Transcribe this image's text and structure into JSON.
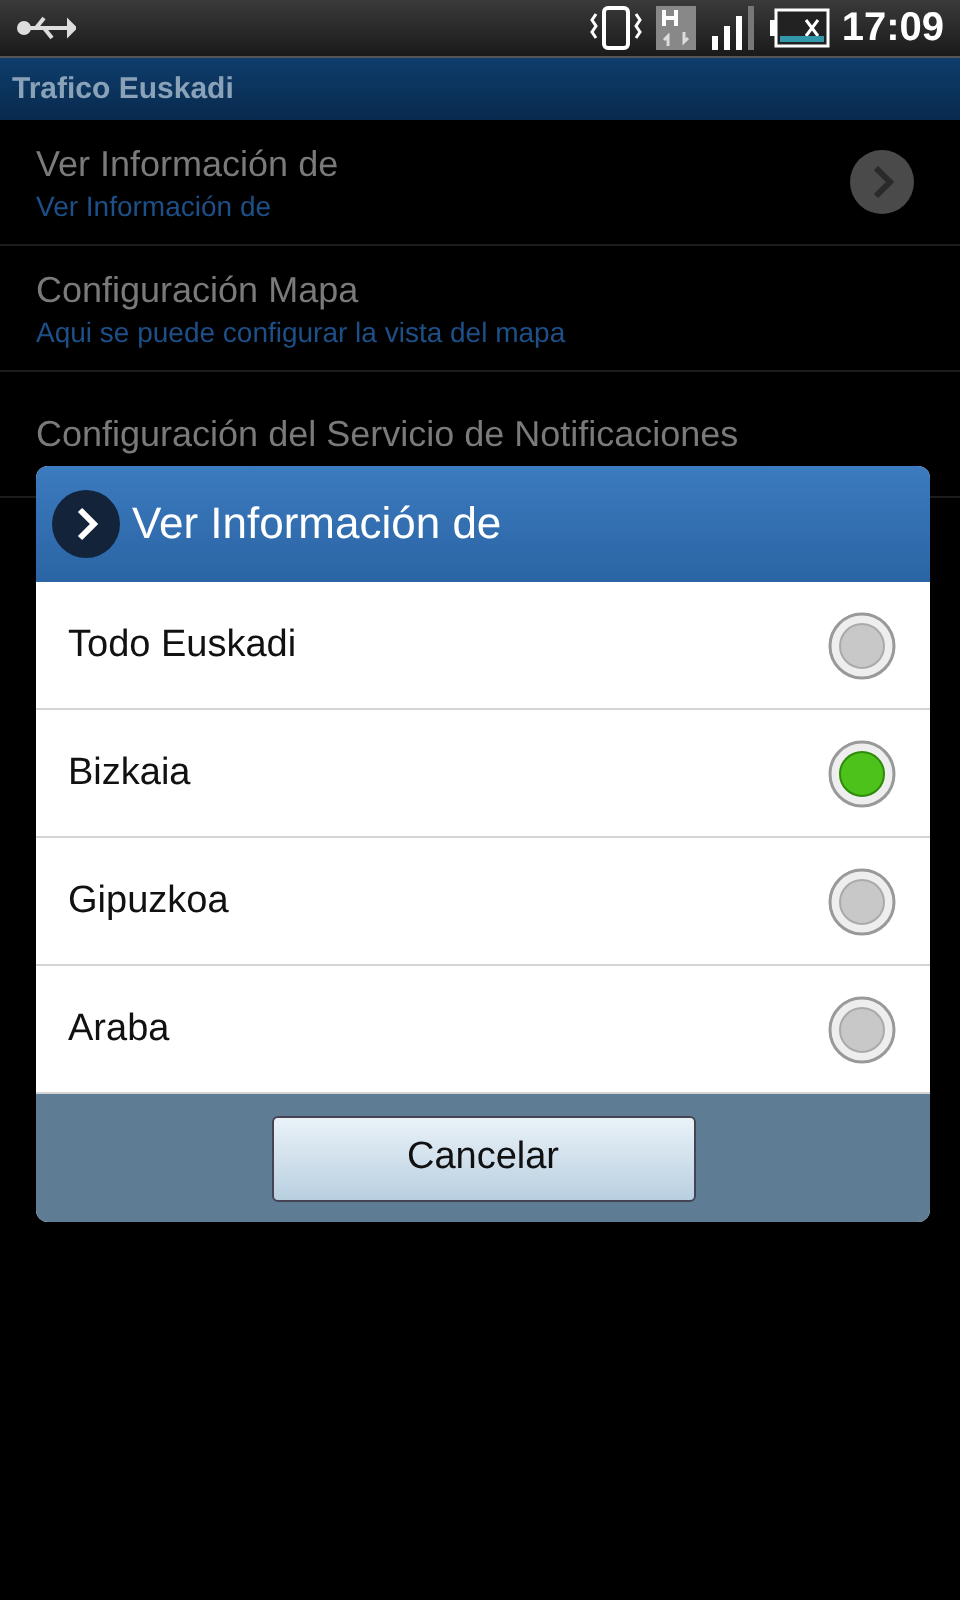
{
  "status_bar": {
    "time": "17:09"
  },
  "app_bar": {
    "title": "Trafico Euskadi"
  },
  "preferences": [
    {
      "title": "Ver Información de",
      "summary": "Ver Información de",
      "kind": "chevron"
    },
    {
      "title": "Configuración Mapa",
      "summary": "Aqui se puede configurar la vista del mapa",
      "kind": "plain"
    },
    {
      "title": "Configuración del Servicio de Notificaciones",
      "kind": "plain"
    }
  ],
  "dialog": {
    "title": "Ver Información de",
    "options": [
      {
        "label": "Todo Euskadi",
        "selected": false
      },
      {
        "label": "Bizkaia",
        "selected": true
      },
      {
        "label": "Gipuzkoa",
        "selected": false
      },
      {
        "label": "Araba",
        "selected": false
      }
    ],
    "button": "Cancelar"
  }
}
